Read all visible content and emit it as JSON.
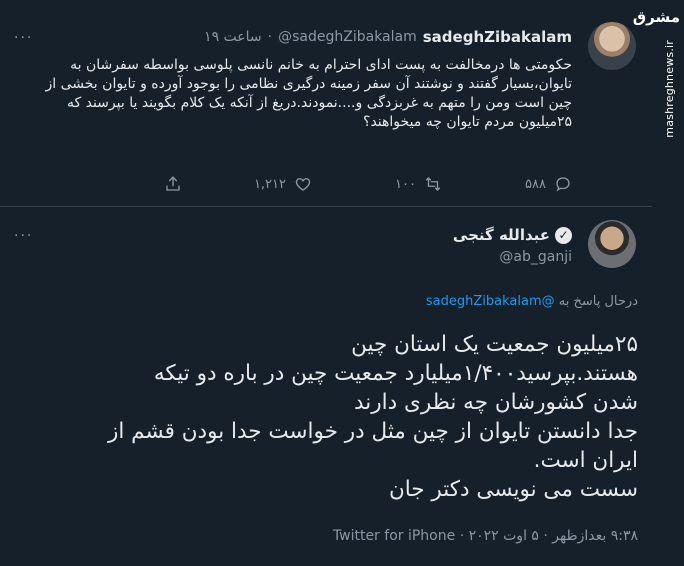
{
  "watermark": {
    "logo_text": "مشرق",
    "site": "mashreghnews.ir"
  },
  "tweet1": {
    "display_name": "sadeghZibakalam",
    "handle": "@sadeghZibakalam",
    "separator": "·",
    "time": "۱۹ ساعت",
    "more": "···",
    "text": "حکومتی ها درمخالفت به پست ادای احترام به خانم نانسی پلوسی بواسطه سفرشان به تایوان،بسیار گفتند و نوشتند آن سفر زمینه درگیری نظامی را بوجود آورده و تایوان بخشی از چین است ومن را متهم به غربزدگی و....نمودند.دریغ از آنکه یک کلام بگویند یا بپرسند که ۲۵میلیون مردم تایوان چه میخواهند؟",
    "reply_count": "۵۸۸",
    "retweet_count": "۱۰۰",
    "like_count": "۱,۲۱۲",
    "icons": [
      "reply-icon",
      "retweet-icon",
      "like-icon",
      "share-icon"
    ]
  },
  "tweet2": {
    "display_name": "عبدالله گنجی",
    "handle": "@ab_ganji",
    "more": "···",
    "reply_prefix": "درحال پاسخ به",
    "reply_mention": "@sadeghZibakalam",
    "lines": [
      "۲۵میلیون جمعیت یک استان چین",
      "هستند.بپرسید۱/۴۰۰میلیارد جمعیت چین در باره دو تیکه",
      "شدن کشورشان چه نظری دارند",
      "جدا دانستن تایوان از چین مثل در خواست جدا بودن قشم از",
      "ایران است.",
      "سست می نویسی دکتر جان"
    ],
    "time": "۹:۳۸ بعدازظهر",
    "date": "۵ اوت ۲۰۲۲",
    "separator": "·",
    "source": "Twitter for iPhone"
  }
}
